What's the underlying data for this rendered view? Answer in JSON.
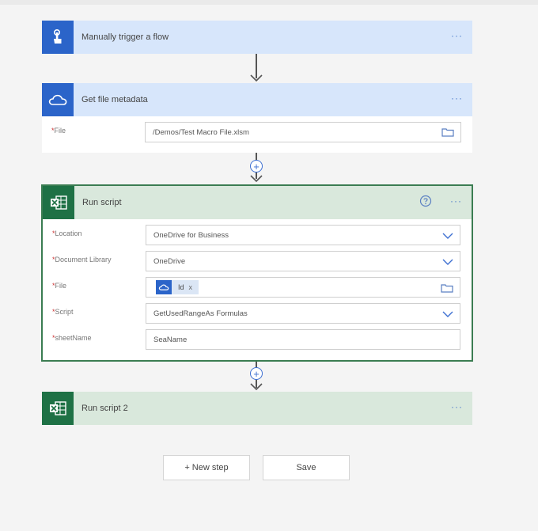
{
  "steps": {
    "trigger": {
      "title": "Manually trigger a flow",
      "more": "···"
    },
    "metadata": {
      "title": "Get file metadata",
      "more": "···",
      "file_label": "File",
      "file_value": "/Demos/Test Macro File.xlsm"
    },
    "run_script": {
      "title": "Run script",
      "more": "···",
      "fields": {
        "location": {
          "label": "Location",
          "value": "OneDrive for Business"
        },
        "document_library": {
          "label": "Document Library",
          "value": "OneDrive"
        },
        "file": {
          "label": "File",
          "token": "Id",
          "token_remove": "x"
        },
        "script": {
          "label": "Script",
          "value": "GetUsedRangeAs Formulas"
        },
        "sheet_name": {
          "label": "sheetName",
          "value": "SeaName"
        }
      }
    },
    "run_script_2": {
      "title": "Run script 2",
      "more": "···"
    }
  },
  "actions": {
    "new_step": "+ New step",
    "save": "Save"
  },
  "required_mark": "*",
  "colors": {
    "trigger_tile": "#2b64c9",
    "onedrive_tile": "#2b64c9",
    "excel_tile": "#1e7145",
    "trigger_header": "#d7e6fb",
    "excel_header": "#d9e8dc",
    "selected_border": "#3b7d52",
    "link": "#3d6fd1"
  },
  "icons": [
    "touch-icon",
    "cloud-icon",
    "excel-icon",
    "folder-icon",
    "chevron-down-icon",
    "help-icon",
    "add-icon",
    "arrow-down-icon"
  ]
}
